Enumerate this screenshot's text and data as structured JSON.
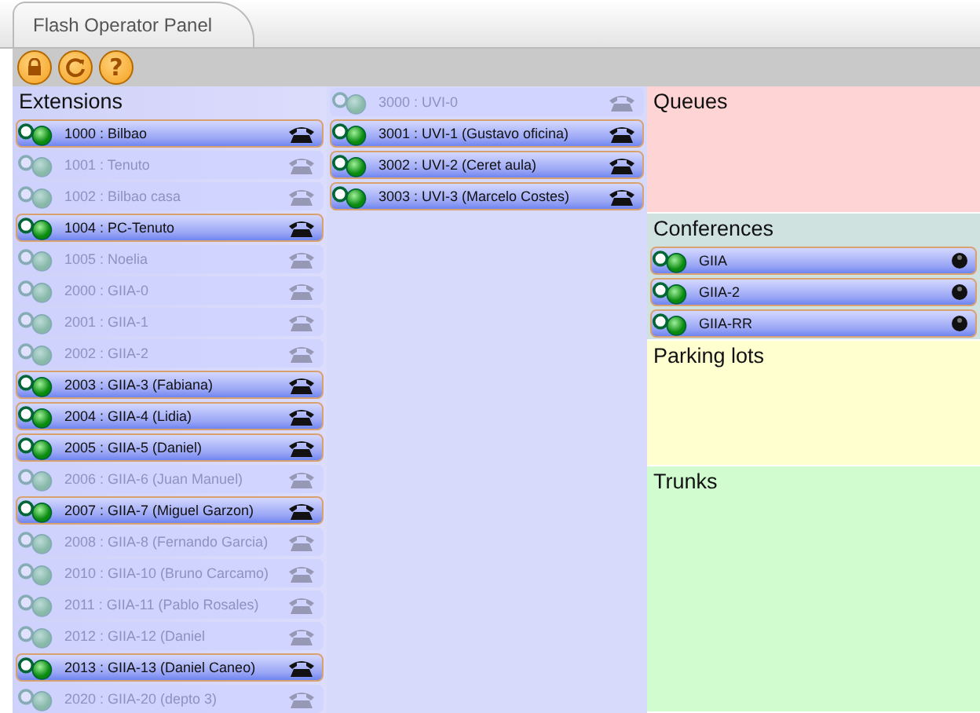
{
  "tabs": [
    {
      "label": "Flash Operator Panel",
      "selected": true
    }
  ],
  "toolbar": {
    "help_label": "?"
  },
  "extensions": {
    "title": "Extensions",
    "items": [
      {
        "label": "1000 : Bilbao",
        "online": true
      },
      {
        "label": "1001 : Tenuto",
        "online": false
      },
      {
        "label": "1002 : Bilbao casa",
        "online": false
      },
      {
        "label": "1004 : PC-Tenuto",
        "online": true
      },
      {
        "label": "1005 : Noelia",
        "online": false
      },
      {
        "label": "2000 : GIIA-0",
        "online": false
      },
      {
        "label": "2001 : GIIA-1",
        "online": false
      },
      {
        "label": "2002 : GIIA-2",
        "online": false
      },
      {
        "label": "2003 : GIIA-3 (Fabiana)",
        "online": true
      },
      {
        "label": "2004 : GIIA-4 (Lidia)",
        "online": true
      },
      {
        "label": "2005 : GIIA-5 (Daniel)",
        "online": true
      },
      {
        "label": "2006 : GIIA-6 (Juan Manuel)",
        "online": false
      },
      {
        "label": "2007 : GIIA-7 (Miguel Garzon)",
        "online": true
      },
      {
        "label": "2008 : GIIA-8 (Fernando Garcia)",
        "online": false
      },
      {
        "label": "2010 : GIIA-10 (Bruno Carcamo)",
        "online": false
      },
      {
        "label": "2011 : GIIA-11 (Pablo Rosales)",
        "online": false
      },
      {
        "label": "2012 : GIIA-12 (Daniel",
        "online": false
      },
      {
        "label": "2013 : GIIA-13 (Daniel Caneo)",
        "online": true
      },
      {
        "label": "2020 : GIIA-20 (depto 3)",
        "online": false
      }
    ],
    "continued": [
      {
        "label": "3000 : UVI-0",
        "online": false
      },
      {
        "label": "3001 : UVI-1 (Gustavo oficina)",
        "online": true
      },
      {
        "label": "3002 : UVI-2 (Ceret aula)",
        "online": true
      },
      {
        "label": "3003 : UVI-3 (Marcelo Costes)",
        "online": true
      }
    ]
  },
  "queues": {
    "title": "Queues"
  },
  "conferences": {
    "title": "Conferences",
    "items": [
      {
        "label": "GIIA",
        "online": true
      },
      {
        "label": "GIIA-2",
        "online": true
      },
      {
        "label": "GIIA-RR",
        "online": true
      }
    ]
  },
  "parking_lots": {
    "title": "Parking lots"
  },
  "trunks": {
    "title": "Trunks"
  }
}
